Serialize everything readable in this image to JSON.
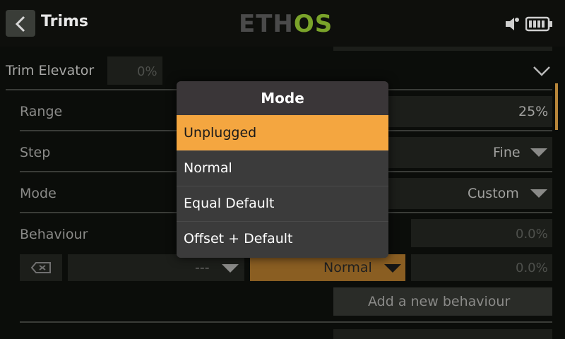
{
  "header": {
    "title": "Trims",
    "logo_left": "ETH",
    "logo_right": "OS"
  },
  "form": {
    "trim_label": "Trim Elevator",
    "trim_value": "0%",
    "range_label": "Range",
    "range_value": "25%",
    "step_label": "Step",
    "step_value": "Fine",
    "mode_label": "Mode",
    "mode_value": "Custom",
    "behaviour_label": "Behaviour",
    "behaviour_value_1": "0.0%",
    "behaviour_source": "---",
    "behaviour_mode": "Normal",
    "behaviour_value_2": "0.0%",
    "add_behaviour": "Add a new behaviour"
  },
  "modal": {
    "title": "Mode",
    "options": [
      "Unplugged",
      "Normal",
      "Equal Default",
      "Offset + Default"
    ],
    "selected_index": 0
  },
  "colors": {
    "accent": "#f4a640",
    "logo_green": "#7aa32a"
  },
  "icons": [
    "back-arrow-icon",
    "audio-icon",
    "battery-icon",
    "chevron-down-icon",
    "delete-icon",
    "dropdown-triangle-icon"
  ]
}
